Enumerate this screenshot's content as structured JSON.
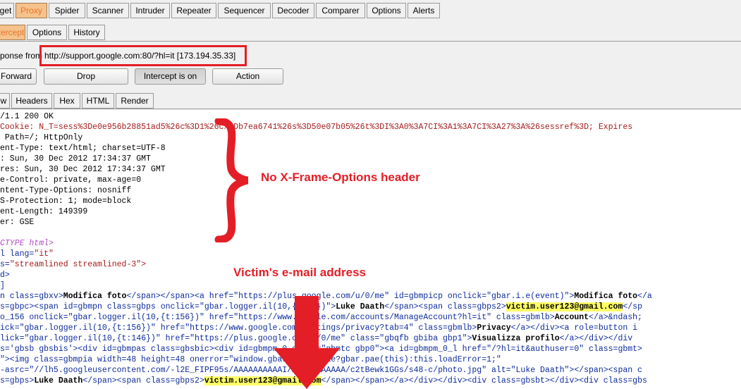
{
  "main_tabs": [
    "get",
    "Proxy",
    "Spider",
    "Scanner",
    "Intruder",
    "Repeater",
    "Sequencer",
    "Decoder",
    "Comparer",
    "Options",
    "Alerts"
  ],
  "proxy_tabs": [
    "tercept",
    "Options",
    "History"
  ],
  "response_prefix": "ponse from",
  "response_url": "http://support.google.com:80/?hl=it  [173.194.35.33]",
  "buttons": {
    "forward": "Forward",
    "drop": "Drop",
    "intercept": "Intercept is on",
    "action": "Action"
  },
  "view_tabs": [
    "w",
    "Headers",
    "Hex",
    "HTML",
    "Render"
  ],
  "annotations": {
    "no_xframe": "No X-Frame-Options header",
    "victim_email": "Victim's e-mail address"
  },
  "header_lines": [
    "/1.1 200 OK",
    "Cookie: N_T=sess%3De0e956b28851ad5%26c%3D1%26c%3Db7ea6741%26s%3D50e07b05%26t%3DI%3A0%3A7CI%3A1%3A7CI%3A27%3A%26sessref%3D; Expires",
    " Path=/; HttpOnly",
    "ent-Type: text/html; charset=UTF-8",
    ": Sun, 30 Dec 2012 17:34:37 GMT",
    "res: Sun, 30 Dec 2012 17:34:37 GMT",
    "e-Control: private, max-age=0",
    "ntent-Type-Options: nosniff",
    "S-Protection: 1; mode=block",
    "ent-Length: 149399",
    "er: GSE"
  ],
  "doctype_line": "CTYPE html>",
  "html_lines": {
    "lang_attr": "l",
    "lang_rest": " lang=",
    "lang_val": "\"it\"",
    "s_attr": "s=",
    "s_val": "\"streamlined streamlined-3\">",
    "d_close": "d>",
    "bracket": "]"
  },
  "code_lines": [
    {
      "pre": "n class=gbxv>",
      "bold": "Modifica foto",
      "post": "</span></span><a href=\"https://plus.google.com/u/0/me\" id=gbmpicp onclick=\"gbar.i.e(event)\">",
      "bold2": "Modifica foto",
      "post2": "</a"
    },
    {
      "pre": "s=gbpc><span id=gbmpn class=gbps onclick=\"gbar.logger.il(10,{t:69})\">",
      "bold": "Luke Daath",
      "post": "</span><span class=gbps2>",
      "email": "victim.user123@gmail.com",
      "post2": "</sp"
    },
    {
      "pre": "o_156 onclick=\"gbar.logger.il(10,{t:156})\" href=\"https://www.google.com/accounts/ManageAccount?hl=it\" class=gbmlb>",
      "bold": "Account",
      "post": "</a>&ndash;"
    },
    {
      "pre": "ick=\"gbar.logger.il(10,{t:156})\" href=\"https://www.google.com/settings/privacy?tab=4\" class=gbmlb>",
      "bold": "Privacy",
      "post": "</a></div><a role=button i"
    },
    {
      "pre": "lick=\"gbar.logger.il(10,{t:146})\" href=\"https://plus.google.com/u/0/me\" class=\"gbqfb gbiba gbp1\">",
      "bold": "Visualizza profilo",
      "post": "</a></div></div"
    },
    {
      "pre": "s='gbsb gbsbis'><div id=gbmpas class=gbsbic><div id=gbmpm_0 class=\"gbmtc gbp0\"><a id=gbmpm_0_l href=\"/?hl=it&authuser=0\" class=gbmt>"
    },
    {
      "pre": "\"><img class=gbmpia width=48 height=48 onerror=\"window.gbar&&gbar.pae?gbar.pae(this):this.loadError=1;\""
    },
    {
      "pre": "-asrc=\"//lh5.googleusercontent.com/-l2E_FIPF95s/AAAAAAAAAAI/AAAAAAAAAAA/c2tBewk1GGs/s48-c/photo.jpg\" alt=\"Luke Daath\"></span><span c"
    },
    {
      "pre": "s=gbps>",
      "bold": "Luke Daath",
      "post": "</span><span class=gbps2>",
      "email": "victim.user123@gmail.com",
      "post2": "</span></span></a></div></div><div class=gbsbt></div><div class=gbs"
    }
  ],
  "colors": {
    "active_tab_text": "#e8742a",
    "annotation_red": "#e41e26",
    "highlight": "#ffff66"
  }
}
